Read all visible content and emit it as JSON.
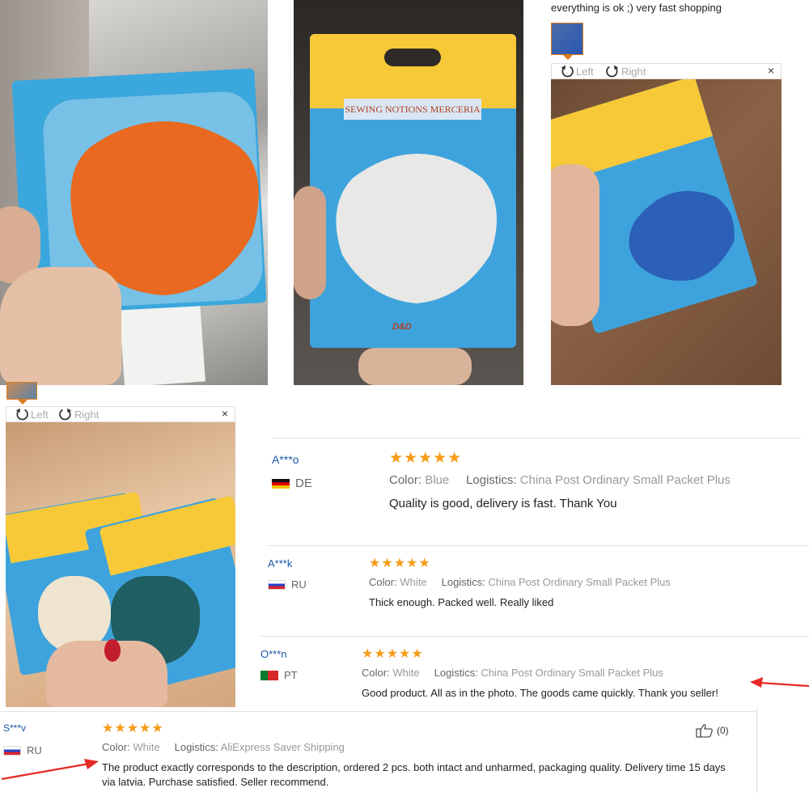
{
  "top_review": {
    "text": "everything is ok ;) very fast shopping"
  },
  "viewer": {
    "left_label": "Left",
    "right_label": "Right",
    "close_label": "×"
  },
  "packaging": {
    "label": "SEWING NOTIONS MERCERIA",
    "brand": "D&D"
  },
  "reviews": [
    {
      "name": "A***o",
      "country": "DE",
      "stars": "★★★★★",
      "color_label": "Color:",
      "color_value": "Blue",
      "logistics_label": "Logistics:",
      "logistics_value": "China Post Ordinary Small Packet Plus",
      "text": "Quality is good, delivery is fast. Thank You"
    },
    {
      "name": "A***k",
      "country": "RU",
      "stars": "★★★★★",
      "color_label": "Color:",
      "color_value": "White",
      "logistics_label": "Logistics:",
      "logistics_value": "China Post Ordinary Small Packet Plus",
      "text": "Thick enough. Packed well. Really liked"
    },
    {
      "name": "O***n",
      "country": "PT",
      "stars": "★★★★★",
      "color_label": "Color:",
      "color_value": "White",
      "logistics_label": "Logistics:",
      "logistics_value": "China Post Ordinary Small Packet Plus",
      "text": "Good product. All as in the photo. The goods came quickly. Thank you seller!"
    },
    {
      "name": "S***v",
      "country": "RU",
      "stars": "★★★★★",
      "color_label": "Color:",
      "color_value": "White",
      "logistics_label": "Logistics:",
      "logistics_value": "AliExpress Saver Shipping",
      "text": "The product exactly corresponds to the description, ordered 2 pcs. both intact and unharmed, packaging quality. Delivery time 15 days via latvia. Purchase satisfied. Seller recommend.",
      "likes": "(0)"
    }
  ],
  "icons": {
    "rotate_left": "rotate-left-icon",
    "rotate_right": "rotate-right-icon",
    "close": "close-icon",
    "thumbs_up": "thumbs-up-icon",
    "star": "star-icon",
    "arrow": "red-arrow"
  },
  "colors": {
    "star": "#f59b16",
    "name_link": "#1a57a7",
    "thumb_border": "#e07b1a",
    "arrow": "#e52b24"
  }
}
